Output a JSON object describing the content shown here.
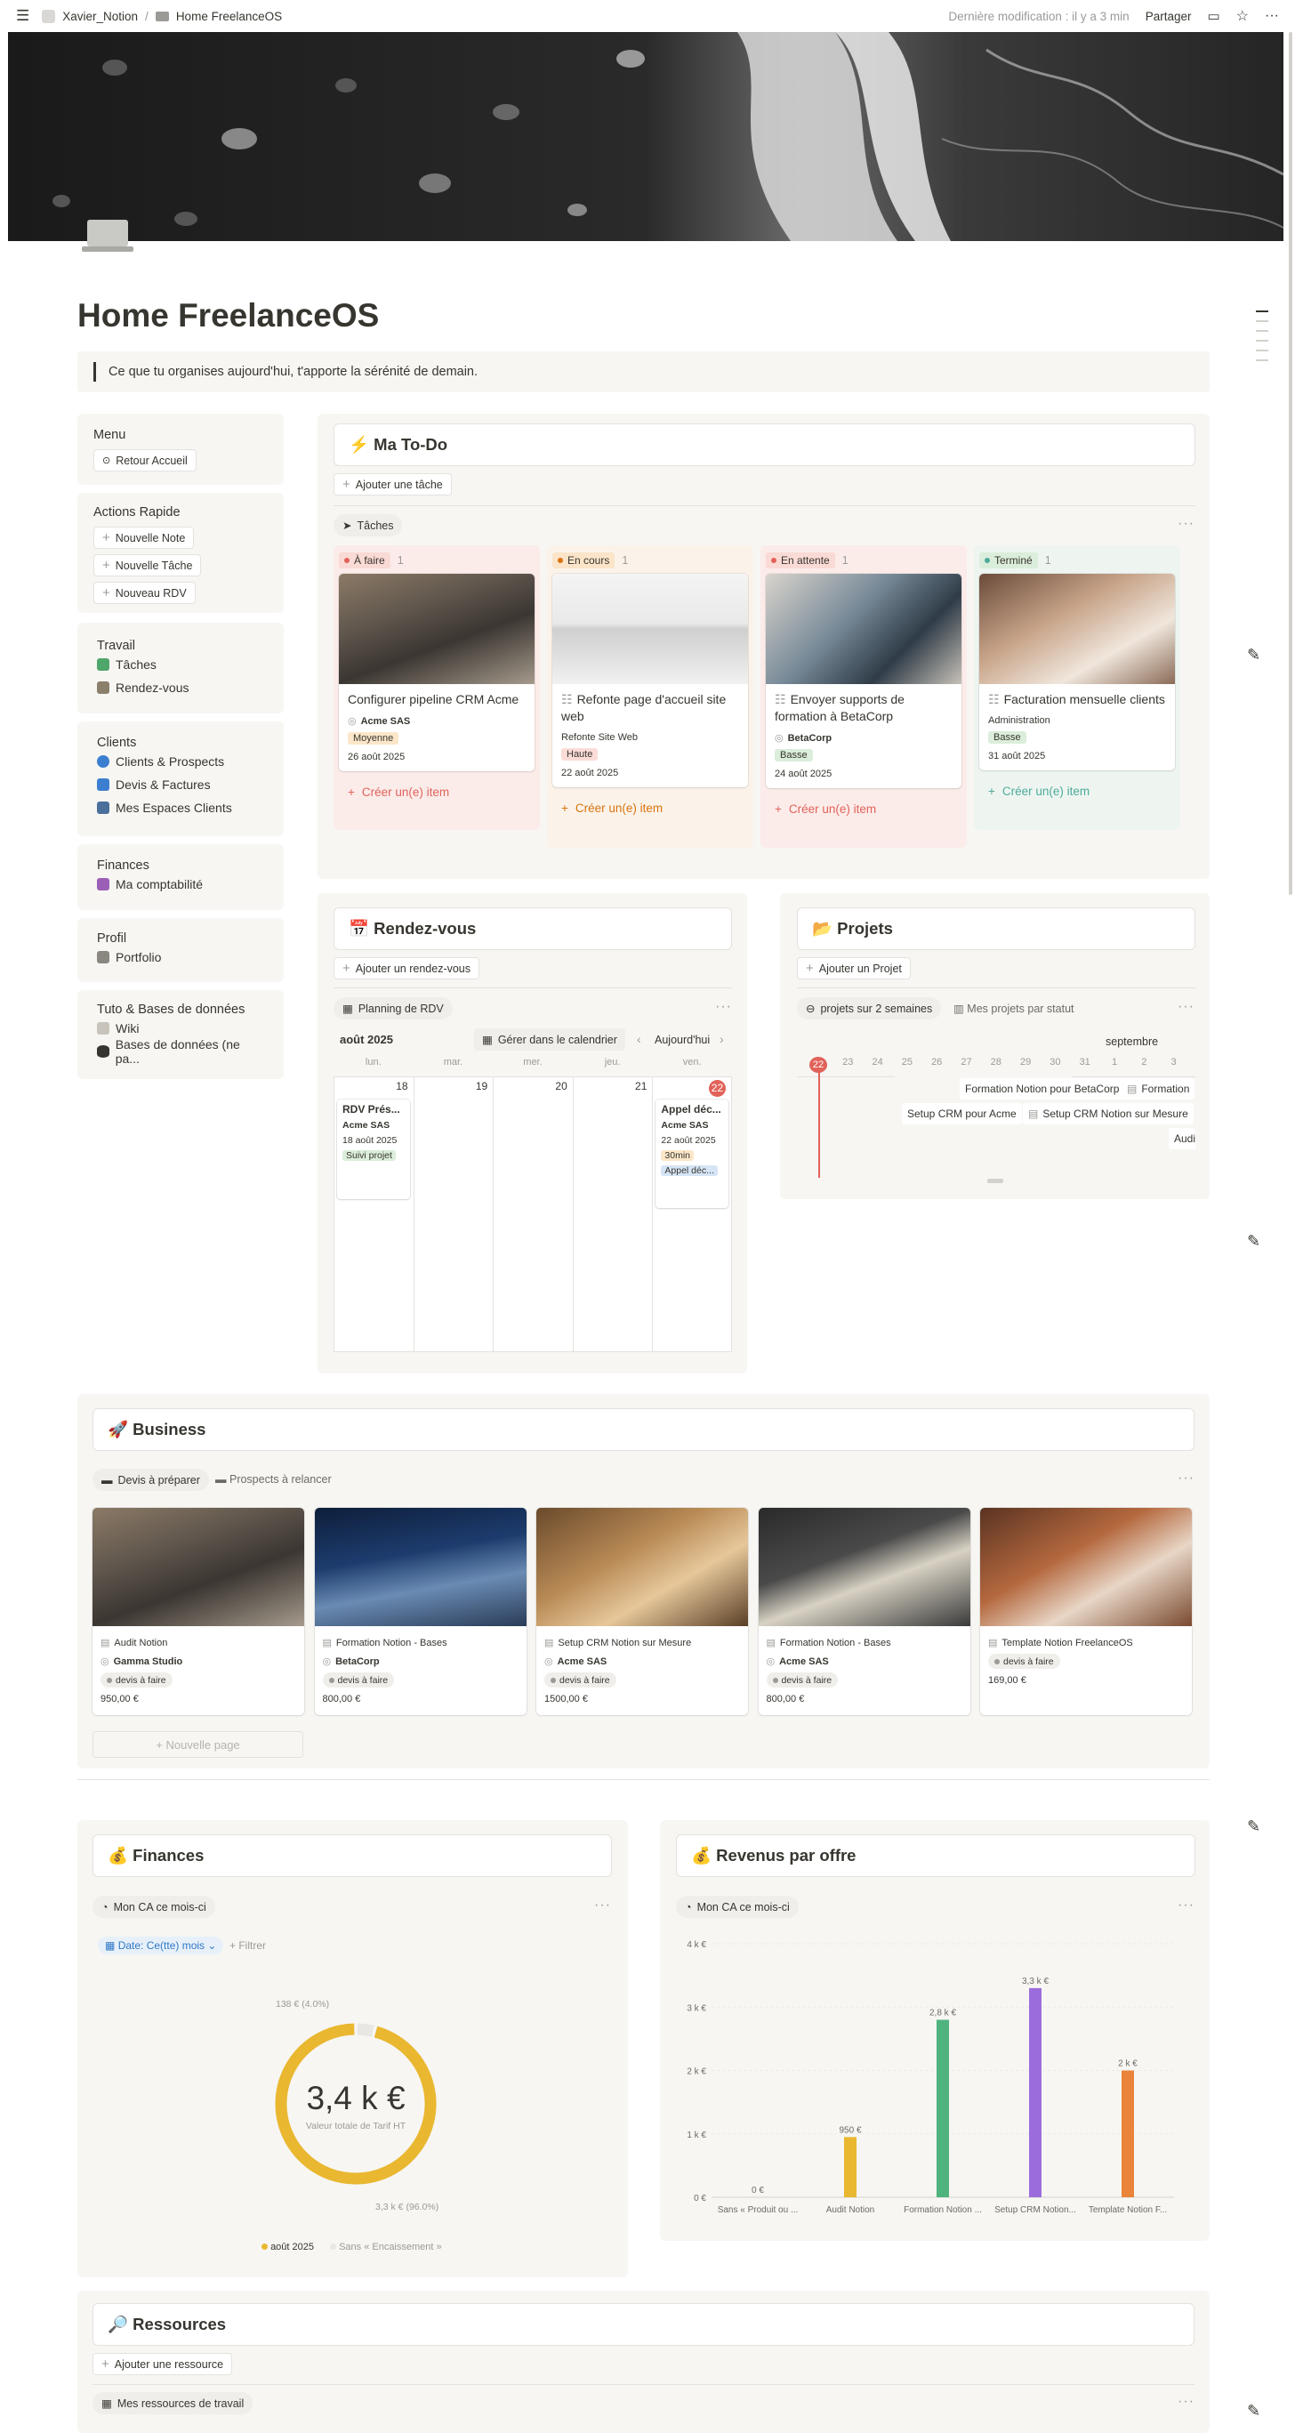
{
  "topbar": {
    "workspace": "Xavier_Notion",
    "separator": "/",
    "page": "Home FreelanceOS",
    "last_edit": "Dernière modification : il y a 3 min",
    "share": "Partager"
  },
  "page": {
    "title": "Home FreelanceOS",
    "quote": "Ce que tu organises aujourd'hui, t'apporte la sérénité de demain."
  },
  "sidebar": {
    "menu": {
      "title": "Menu",
      "button": "Retour Accueil"
    },
    "actions": {
      "title": "Actions Rapide",
      "buttons": [
        "Nouvelle Note",
        "Nouvelle Tâche",
        "Nouveau RDV"
      ]
    },
    "travail": {
      "title": "Travail",
      "links": [
        "Tâches",
        "Rendez-vous"
      ]
    },
    "clients": {
      "title": "Clients",
      "links": [
        "Clients & Prospects",
        "Devis & Factures",
        "Mes Espaces Clients"
      ]
    },
    "finances": {
      "title": "Finances",
      "links": [
        "Ma comptabilité"
      ]
    },
    "profil": {
      "title": "Profil",
      "links": [
        "Portfolio"
      ]
    },
    "tuto": {
      "title": "Tuto & Bases de données",
      "links": [
        "Wiki",
        "Bases de données (ne pa..."
      ]
    }
  },
  "todo": {
    "title": "⚡ Ma To-Do",
    "add": "Ajouter une tâche",
    "view": "Tâches",
    "add_item": "Créer un(e) item",
    "columns": [
      {
        "name": "À faire",
        "count": "1",
        "color": "#e16259",
        "bg": "#fbecea",
        "tagbg": "#fadad5",
        "card": {
          "title": "Configurer pipeline CRM Acme",
          "client": "Acme SAS",
          "tag": "Moyenne",
          "tagcolor": "#fbe6c9",
          "date": "26 août 2025"
        }
      },
      {
        "name": "En cours",
        "count": "1",
        "color": "#d9730d",
        "bg": "#fbf3ea",
        "tagbg": "#fbe4c8",
        "card": {
          "title": "Refonte page d'accueil site web",
          "client": "Refonte Site Web",
          "tag": "Haute",
          "tagcolor": "#fbdcd7",
          "date": "22 août 2025"
        }
      },
      {
        "name": "En attente",
        "count": "1",
        "color": "#e16259",
        "bg": "#fbecea",
        "tagbg": "#fadad5",
        "card": {
          "title": "Envoyer supports de formation à BetaCorp",
          "client": "BetaCorp",
          "tag": "Basse",
          "tagcolor": "#dbeddb",
          "date": "24 août 2025"
        }
      },
      {
        "name": "Terminé",
        "count": "1",
        "color": "#4dab9a",
        "bg": "#eef5f1",
        "tagbg": "#dbeddb",
        "card": {
          "title": "Facturation mensuelle clients",
          "client": "Administration",
          "tag": "Basse",
          "tagcolor": "#dbeddb",
          "date": "31 août 2025"
        }
      }
    ]
  },
  "rdv": {
    "title": "📅 Rendez-vous",
    "add": "Ajouter un rendez-vous",
    "view": "Planning de RDV",
    "month": "août 2025",
    "manage": "Gérer dans le calendrier",
    "today": "Aujourd'hui",
    "days": [
      "lun.",
      "mar.",
      "mer.",
      "jeu.",
      "ven."
    ],
    "dates": [
      "18",
      "19",
      "20",
      "21",
      "22"
    ],
    "event1": {
      "title": "RDV Prés...",
      "client": "Acme SAS",
      "date": "18 août 2025",
      "tag": "Suivi projet"
    },
    "event2": {
      "title": "Appel déc...",
      "client": "Acme SAS",
      "date": "22 août 2025",
      "duration": "30min",
      "tag": "Appel déc..."
    }
  },
  "projets": {
    "title": "📂 Projets",
    "add": "Ajouter un Projet",
    "view1": "projets sur 2 semaines",
    "view2": "Mes projets par statut",
    "month": "septembre",
    "ticks": [
      "22",
      "23",
      "24",
      "25",
      "26",
      "27",
      "28",
      "29",
      "30",
      "31",
      "1",
      "2",
      "3"
    ],
    "bars": [
      "Formation Notion pour BetaCorp",
      "Formation",
      "Setup CRM pour Acme",
      "Setup CRM Notion sur Mesure",
      "Audi"
    ]
  },
  "business": {
    "title": "🚀 Business",
    "view1": "Devis à préparer",
    "view2": "Prospects à relancer",
    "new_page": "Nouvelle page",
    "cards": [
      {
        "title": "Audit Notion",
        "client": "Gamma Studio",
        "tag": "devis à faire",
        "amount": "950,00 €"
      },
      {
        "title": "Formation Notion - Bases",
        "client": "BetaCorp",
        "tag": "devis à faire",
        "amount": "800,00 €"
      },
      {
        "title": "Setup CRM Notion sur Mesure",
        "client": "Acme SAS",
        "tag": "devis à faire",
        "amount": "1500,00 €"
      },
      {
        "title": "Formation Notion - Bases",
        "client": "Acme SAS",
        "tag": "devis à faire",
        "amount": "800,00 €"
      },
      {
        "title": "Template Notion FreelanceOS",
        "client": "",
        "tag": "devis à faire",
        "amount": "169,00 €"
      }
    ]
  },
  "finances": {
    "title": "💰 Finances",
    "view": "Mon CA ce mois-ci",
    "filter_date": "Date: Ce(tte) mois",
    "filter": "+ Filtrer",
    "donut": {
      "value": "3,4 k €",
      "sub": "Valeur totale de Tarif HT",
      "label_small": "138 € (4.0%)",
      "label_big": "3,3 k € (96.0%)",
      "legend": [
        "août 2025",
        "Sans « Encaissement »"
      ],
      "shares": [
        0.96,
        0.04
      ],
      "colors": [
        "#e9b730",
        "#e8e7e4"
      ]
    }
  },
  "chart_data": {
    "type": "bar",
    "title": "💰 Revenus par offre",
    "view": "Mon CA ce mois-ci",
    "categories": [
      "Sans « Produit ou ...",
      "Audit Notion",
      "Formation Notion ...",
      "Setup CRM Notion...",
      "Template Notion F..."
    ],
    "values": [
      0,
      950,
      2800,
      3300,
      2000
    ],
    "value_labels": [
      "0 €",
      "950 €",
      "2,8 k €",
      "3,3 k €",
      "2 k €"
    ],
    "colors": [
      "#9b9a97",
      "#e9b730",
      "#4fb37e",
      "#9b6ddc",
      "#e9843a"
    ],
    "yticks": [
      "0 €",
      "1 k €",
      "2 k €",
      "3 k €",
      "4 k €"
    ],
    "ylim": [
      0,
      4000
    ]
  },
  "ressources": {
    "title": "🔎 Ressources",
    "add": "Ajouter une ressource",
    "view": "Mes ressources de travail"
  }
}
